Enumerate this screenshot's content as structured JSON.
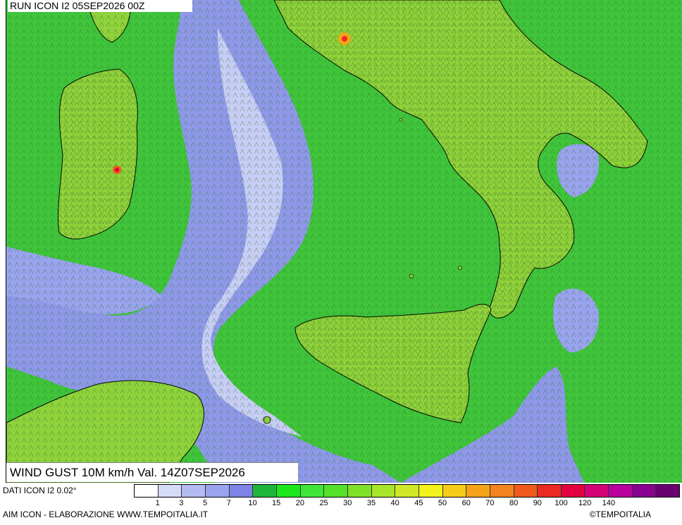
{
  "header": {
    "run_label": "RUN ICON I2 05SEP2026 00Z"
  },
  "map": {
    "variable_label": "WIND GUST 10M km/h Val. 14Z07SEP2026",
    "sea_base_color": "#3fc43a",
    "land_color": "#8fd23a",
    "calm_color": "#8f98e8"
  },
  "legend": {
    "colors": [
      "#ffffff",
      "#d6dbf7",
      "#b3bbf2",
      "#9aa3ee",
      "#7d84e6",
      "#1fb53c",
      "#1ce61c",
      "#3ee63a",
      "#55e02a",
      "#7fe028",
      "#a8e62a",
      "#cfe82a",
      "#f4f21a",
      "#f6cc18",
      "#f5a319",
      "#f3831c",
      "#ef5a1c",
      "#ea2b22",
      "#e2003f",
      "#d40075",
      "#b8009d",
      "#8a0090",
      "#6a0070"
    ],
    "ticks": [
      "1",
      "3",
      "5",
      "7",
      "10",
      "15",
      "20",
      "25",
      "30",
      "35",
      "40",
      "45",
      "50",
      "60",
      "70",
      "80",
      "90",
      "100",
      "120",
      "140"
    ]
  },
  "footer": {
    "dati": "DATI ICON I2 0.02°",
    "aim": "AIM ICON - ELABORAZIONE WWW.TEMPOITALIA.IT",
    "copyright": "©TEMPOITALIA"
  }
}
